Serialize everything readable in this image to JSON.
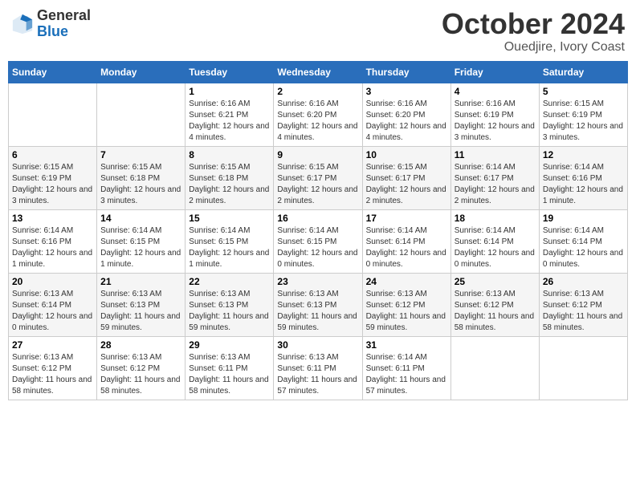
{
  "header": {
    "logo_general": "General",
    "logo_blue": "Blue",
    "month_title": "October 2024",
    "subtitle": "Ouedjire, Ivory Coast"
  },
  "weekdays": [
    "Sunday",
    "Monday",
    "Tuesday",
    "Wednesday",
    "Thursday",
    "Friday",
    "Saturday"
  ],
  "weeks": [
    [
      null,
      null,
      {
        "day": 1,
        "sunrise": "6:16 AM",
        "sunset": "6:21 PM",
        "daylight": "12 hours and 4 minutes."
      },
      {
        "day": 2,
        "sunrise": "6:16 AM",
        "sunset": "6:20 PM",
        "daylight": "12 hours and 4 minutes."
      },
      {
        "day": 3,
        "sunrise": "6:16 AM",
        "sunset": "6:20 PM",
        "daylight": "12 hours and 4 minutes."
      },
      {
        "day": 4,
        "sunrise": "6:16 AM",
        "sunset": "6:19 PM",
        "daylight": "12 hours and 3 minutes."
      },
      {
        "day": 5,
        "sunrise": "6:15 AM",
        "sunset": "6:19 PM",
        "daylight": "12 hours and 3 minutes."
      }
    ],
    [
      {
        "day": 6,
        "sunrise": "6:15 AM",
        "sunset": "6:19 PM",
        "daylight": "12 hours and 3 minutes."
      },
      {
        "day": 7,
        "sunrise": "6:15 AM",
        "sunset": "6:18 PM",
        "daylight": "12 hours and 3 minutes."
      },
      {
        "day": 8,
        "sunrise": "6:15 AM",
        "sunset": "6:18 PM",
        "daylight": "12 hours and 2 minutes."
      },
      {
        "day": 9,
        "sunrise": "6:15 AM",
        "sunset": "6:17 PM",
        "daylight": "12 hours and 2 minutes."
      },
      {
        "day": 10,
        "sunrise": "6:15 AM",
        "sunset": "6:17 PM",
        "daylight": "12 hours and 2 minutes."
      },
      {
        "day": 11,
        "sunrise": "6:14 AM",
        "sunset": "6:17 PM",
        "daylight": "12 hours and 2 minutes."
      },
      {
        "day": 12,
        "sunrise": "6:14 AM",
        "sunset": "6:16 PM",
        "daylight": "12 hours and 1 minute."
      }
    ],
    [
      {
        "day": 13,
        "sunrise": "6:14 AM",
        "sunset": "6:16 PM",
        "daylight": "12 hours and 1 minute."
      },
      {
        "day": 14,
        "sunrise": "6:14 AM",
        "sunset": "6:15 PM",
        "daylight": "12 hours and 1 minute."
      },
      {
        "day": 15,
        "sunrise": "6:14 AM",
        "sunset": "6:15 PM",
        "daylight": "12 hours and 1 minute."
      },
      {
        "day": 16,
        "sunrise": "6:14 AM",
        "sunset": "6:15 PM",
        "daylight": "12 hours and 0 minutes."
      },
      {
        "day": 17,
        "sunrise": "6:14 AM",
        "sunset": "6:14 PM",
        "daylight": "12 hours and 0 minutes."
      },
      {
        "day": 18,
        "sunrise": "6:14 AM",
        "sunset": "6:14 PM",
        "daylight": "12 hours and 0 minutes."
      },
      {
        "day": 19,
        "sunrise": "6:14 AM",
        "sunset": "6:14 PM",
        "daylight": "12 hours and 0 minutes."
      }
    ],
    [
      {
        "day": 20,
        "sunrise": "6:13 AM",
        "sunset": "6:14 PM",
        "daylight": "12 hours and 0 minutes."
      },
      {
        "day": 21,
        "sunrise": "6:13 AM",
        "sunset": "6:13 PM",
        "daylight": "11 hours and 59 minutes."
      },
      {
        "day": 22,
        "sunrise": "6:13 AM",
        "sunset": "6:13 PM",
        "daylight": "11 hours and 59 minutes."
      },
      {
        "day": 23,
        "sunrise": "6:13 AM",
        "sunset": "6:13 PM",
        "daylight": "11 hours and 59 minutes."
      },
      {
        "day": 24,
        "sunrise": "6:13 AM",
        "sunset": "6:12 PM",
        "daylight": "11 hours and 59 minutes."
      },
      {
        "day": 25,
        "sunrise": "6:13 AM",
        "sunset": "6:12 PM",
        "daylight": "11 hours and 58 minutes."
      },
      {
        "day": 26,
        "sunrise": "6:13 AM",
        "sunset": "6:12 PM",
        "daylight": "11 hours and 58 minutes."
      }
    ],
    [
      {
        "day": 27,
        "sunrise": "6:13 AM",
        "sunset": "6:12 PM",
        "daylight": "11 hours and 58 minutes."
      },
      {
        "day": 28,
        "sunrise": "6:13 AM",
        "sunset": "6:12 PM",
        "daylight": "11 hours and 58 minutes."
      },
      {
        "day": 29,
        "sunrise": "6:13 AM",
        "sunset": "6:11 PM",
        "daylight": "11 hours and 58 minutes."
      },
      {
        "day": 30,
        "sunrise": "6:13 AM",
        "sunset": "6:11 PM",
        "daylight": "11 hours and 57 minutes."
      },
      {
        "day": 31,
        "sunrise": "6:14 AM",
        "sunset": "6:11 PM",
        "daylight": "11 hours and 57 minutes."
      },
      null,
      null
    ]
  ]
}
